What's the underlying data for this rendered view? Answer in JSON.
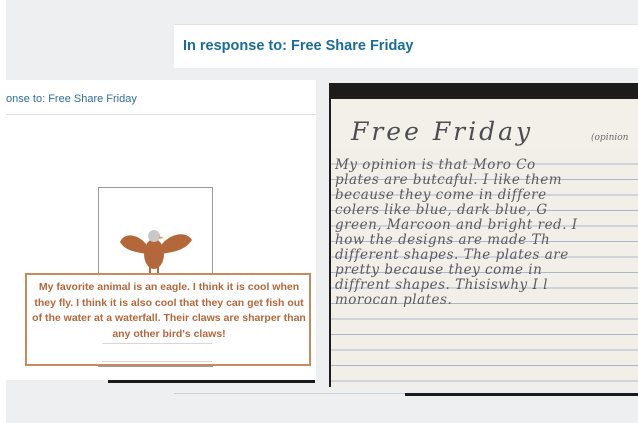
{
  "header": {
    "title": "In response to: Free Share Friday"
  },
  "post": {
    "heading": "onse to: Free Share Friday",
    "caption": "My favorite animal is an eagle. I think it is cool when they fly. I think it is also cool that they can get fish out of the water at a waterfall. Their claws are sharper than any other bird's claws!"
  },
  "handwriting": {
    "title": "Free  Friday",
    "tag": "(opinion",
    "lines": [
      "My opinion is that Moro Co",
      "plates are butcaful. I like them",
      "because they come in differe",
      "colers like blue, dark blue, G",
      "green, Marcoon and bright red. I",
      "how the designs are made Th",
      "different shapes. The plates are",
      "pretty because they come in",
      "diffrent shapes. Thisiswhy I l",
      "morocan plates."
    ]
  },
  "colors": {
    "accent": "#1a6c9a",
    "caption_text": "#b5673c",
    "caption_border": "#c98a5e",
    "eagle": "#b5673c"
  }
}
